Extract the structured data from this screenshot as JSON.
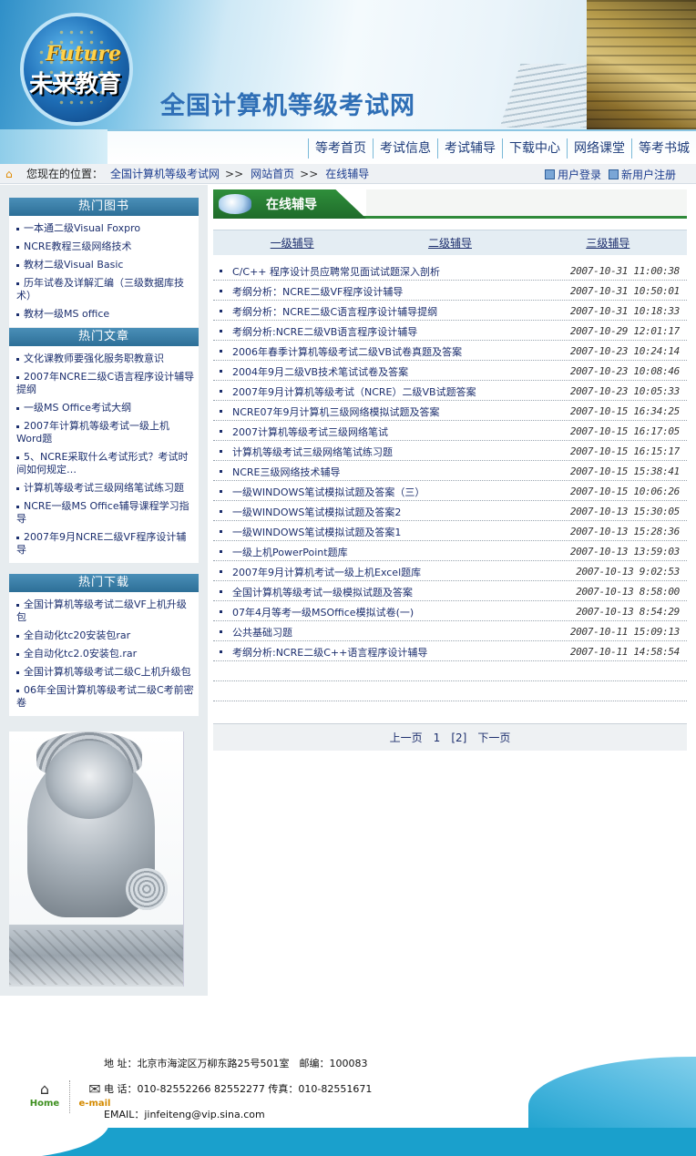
{
  "header": {
    "logo_en": "Future",
    "logo_cn": "未来教育",
    "site_title": "全国计算机等级考试网"
  },
  "nav": [
    "等考首页",
    "考试信息",
    "考试辅导",
    "下载中心",
    "网络课堂",
    "等考书城"
  ],
  "breadcrumb": {
    "label": "您现在的位置：",
    "items": [
      "全国计算机等级考试网",
      "网站首页",
      "在线辅导"
    ],
    "sep": ">>"
  },
  "user_links": {
    "login": "用户登录",
    "register": "新用户注册"
  },
  "sidebar": {
    "books": {
      "title": "热门图书",
      "items": [
        "一本通二级Visual Foxpro",
        "NCRE教程三级网络技术",
        "教材二级Visual Basic",
        "历年试卷及详解汇编（三级数据库技术）",
        "教材一级MS office"
      ]
    },
    "articles": {
      "title": "热门文章",
      "items": [
        "文化课教师要强化服务职教意识",
        "2007年NCRE二级C语言程序设计辅导提纲",
        "一级MS Office考试大纲",
        "2007年计算机等级考试一级上机Word题",
        "5、NCRE采取什么考试形式？考试时间如何规定…",
        "计算机等级考试三级网络笔试练习题",
        "NCRE一级MS Office辅导课程学习指导",
        "2007年9月NCRE二级VF程序设计辅导"
      ]
    },
    "downloads": {
      "title": "热门下载",
      "items": [
        "全国计算机等级考试二级VF上机升级包",
        "全自动化tc20安装包rar",
        "全自动化tc2.0安装包.rar",
        "全国计算机等级考试二级C上机升级包",
        "06年全国计算机等级考试二级C考前密卷"
      ]
    }
  },
  "main": {
    "section_title": "在线辅导",
    "level_tabs": [
      "一级辅导",
      "二级辅导",
      "三级辅导"
    ],
    "articles": [
      {
        "title": "C/C++ 程序设计员应聘常见面试试题深入剖析",
        "date": "2007-10-31 11:00:38"
      },
      {
        "title": "考纲分析：NCRE二级VF程序设计辅导",
        "date": "2007-10-31 10:50:01"
      },
      {
        "title": "考纲分析：NCRE二级C语言程序设计辅导提纲",
        "date": "2007-10-31 10:18:33"
      },
      {
        "title": "考纲分析:NCRE二级VB语言程序设计辅导",
        "date": "2007-10-29 12:01:17"
      },
      {
        "title": "2006年春季计算机等级考试二级VB试卷真题及答案",
        "date": "2007-10-23 10:24:14"
      },
      {
        "title": "2004年9月二级VB技术笔试试卷及答案",
        "date": "2007-10-23 10:08:46"
      },
      {
        "title": "2007年9月计算机等级考试（NCRE）二级VB试题答案",
        "date": "2007-10-23 10:05:33"
      },
      {
        "title": "NCRE07年9月计算机三级网络模拟试题及答案",
        "date": "2007-10-15 16:34:25"
      },
      {
        "title": "2007计算机等级考试三级网络笔试",
        "date": "2007-10-15 16:17:05"
      },
      {
        "title": "计算机等级考试三级网络笔试练习题",
        "date": "2007-10-15 16:15:17"
      },
      {
        "title": "NCRE三级网络技术辅导",
        "date": "2007-10-15 15:38:41"
      },
      {
        "title": "一级WINDOWS笔试模拟试题及答案（三）",
        "date": "2007-10-15 10:06:26"
      },
      {
        "title": "一级WINDOWS笔试模拟试题及答案2",
        "date": "2007-10-13 15:30:05"
      },
      {
        "title": "一级WINDOWS笔试模拟试题及答案1",
        "date": "2007-10-13 15:28:36"
      },
      {
        "title": "一级上机PowerPoint题库",
        "date": "2007-10-13 13:59:03"
      },
      {
        "title": "2007年9月计算机考试一级上机Excel题库",
        "date": "2007-10-13 9:02:53"
      },
      {
        "title": "全国计算机等级考试一级模拟试题及答案",
        "date": "2007-10-13 8:58:00"
      },
      {
        "title": "07年4月等考一级MSOffice模拟试卷(一)",
        "date": "2007-10-13 8:54:29"
      },
      {
        "title": "公共基础习题",
        "date": "2007-10-11 15:09:13"
      },
      {
        "title": "考纲分析:NCRE二级C++语言程序设计辅导",
        "date": "2007-10-11 14:58:54"
      }
    ],
    "pager": {
      "prev": "上一页",
      "current": "1",
      "page2": "[2]",
      "next": "下一页"
    }
  },
  "footer": {
    "home_label": "Home",
    "email_label": "e-mail",
    "address": "地 址：北京市海淀区万柳东路25号501室　邮编：100083",
    "phone": "电 话：010-82552266 82552277 传真：010-82551671",
    "email": "EMAIL：jinfeiteng@vip.sina.com"
  }
}
